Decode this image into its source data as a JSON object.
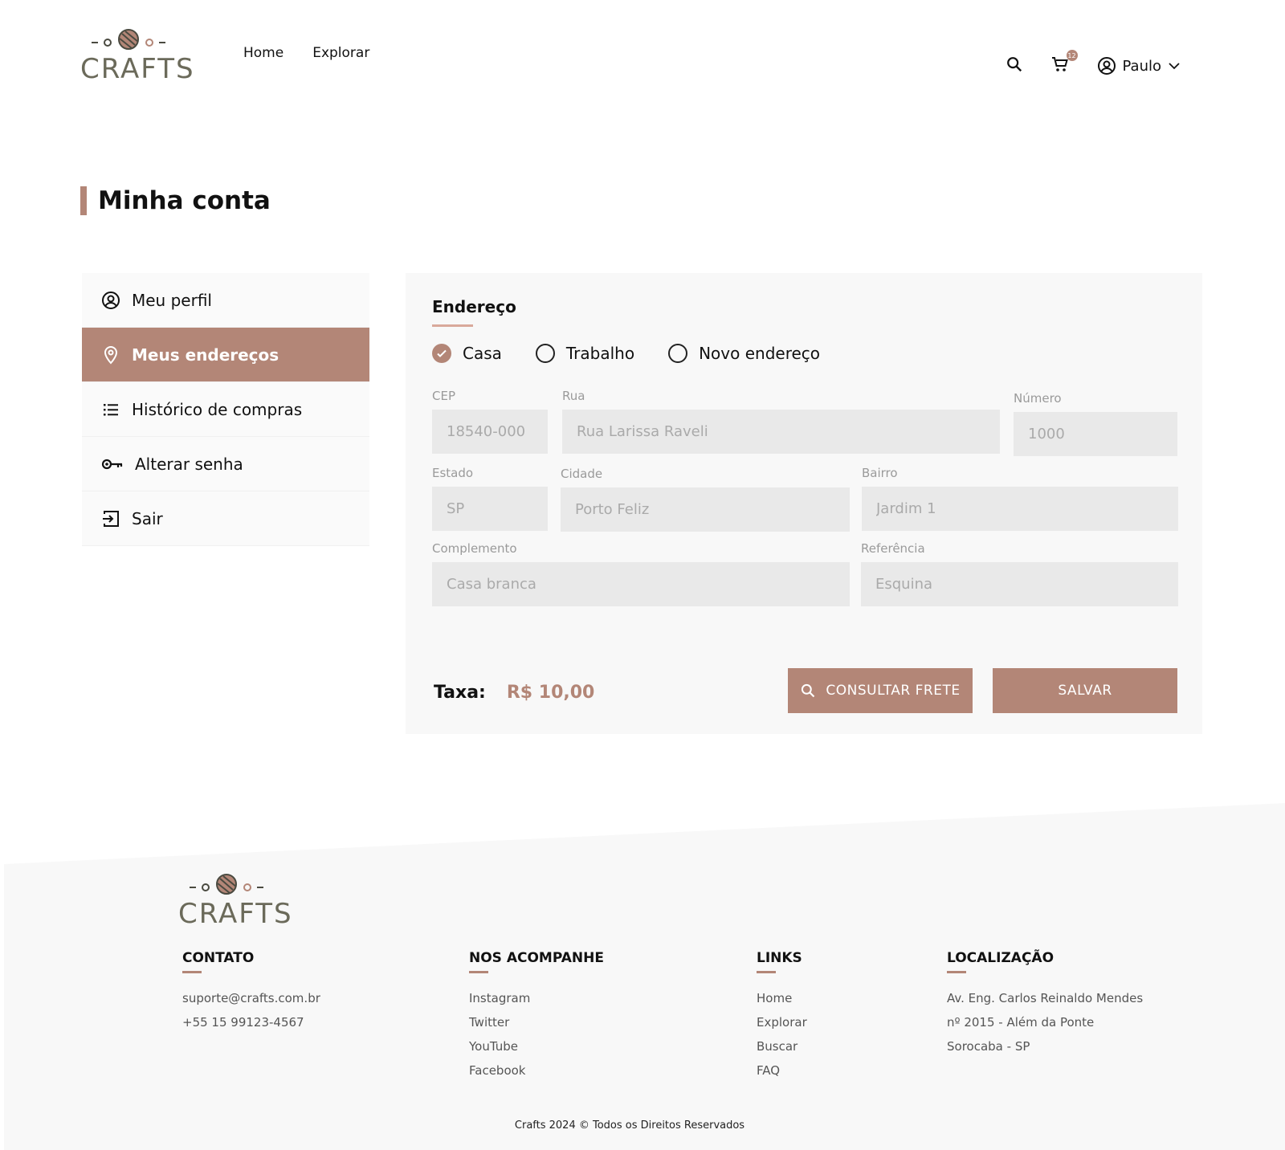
{
  "brand": {
    "logo_text": "CRAFTS",
    "accent_color": "#b38677"
  },
  "header": {
    "nav": [
      "Home",
      "Explorar"
    ],
    "cart_count": "12",
    "user_name": "Paulo",
    "icons": [
      "search-icon",
      "cart-icon",
      "user-icon",
      "chevron-down-icon"
    ]
  },
  "page": {
    "title": "Minha conta"
  },
  "sidebar": {
    "items": [
      {
        "label": "Meu perfil",
        "icon": "user-circle-icon",
        "active": false
      },
      {
        "label": "Meus endereços",
        "icon": "location-pin-icon",
        "active": true
      },
      {
        "label": "Histórico de compras",
        "icon": "list-icon",
        "active": false
      },
      {
        "label": "Alterar senha",
        "icon": "key-icon",
        "active": false
      },
      {
        "label": "Sair",
        "icon": "logout-icon",
        "active": false
      }
    ]
  },
  "address": {
    "title": "Endereço",
    "options": [
      {
        "label": "Casa",
        "selected": true
      },
      {
        "label": "Trabalho",
        "selected": false
      },
      {
        "label": "Novo endereço",
        "selected": false
      }
    ],
    "fields": {
      "cep": {
        "label": "CEP",
        "placeholder": "18540-000"
      },
      "rua": {
        "label": "Rua",
        "placeholder": "Rua Larissa Raveli"
      },
      "numero": {
        "label": "Número",
        "placeholder": "1000"
      },
      "estado": {
        "label": "Estado",
        "placeholder": "SP"
      },
      "cidade": {
        "label": "Cidade",
        "placeholder": "Porto Feliz"
      },
      "bairro": {
        "label": "Bairro",
        "placeholder": "Jardim 1"
      },
      "complemento": {
        "label": "Complemento",
        "placeholder": "Casa branca"
      },
      "referencia": {
        "label": "Referência",
        "placeholder": "Esquina"
      }
    },
    "taxa_label": "Taxa:",
    "taxa_value": "R$ 10,00",
    "consult_button": "CONSULTAR FRETE",
    "save_button": "SALVAR"
  },
  "footer": {
    "logo_text": "CRAFTS",
    "contato": {
      "title": "CONTATO",
      "lines": [
        "suporte@crafts.com.br",
        "+55 15 99123-4567"
      ]
    },
    "social": {
      "title": "NOS ACOMPANHE",
      "lines": [
        "Instagram",
        "Twitter",
        "YouTube",
        "Facebook"
      ]
    },
    "links": {
      "title": "LINKS",
      "lines": [
        "Home",
        "Explorar",
        "Buscar",
        "FAQ"
      ]
    },
    "local": {
      "title": "LOCALIZAÇÃO",
      "lines": [
        "Av. Eng. Carlos Reinaldo Mendes",
        "nº 2015  - Além da Ponte",
        "Sorocaba - SP"
      ]
    },
    "copyright": "Crafts 2024 © Todos os Direitos Reservados"
  }
}
